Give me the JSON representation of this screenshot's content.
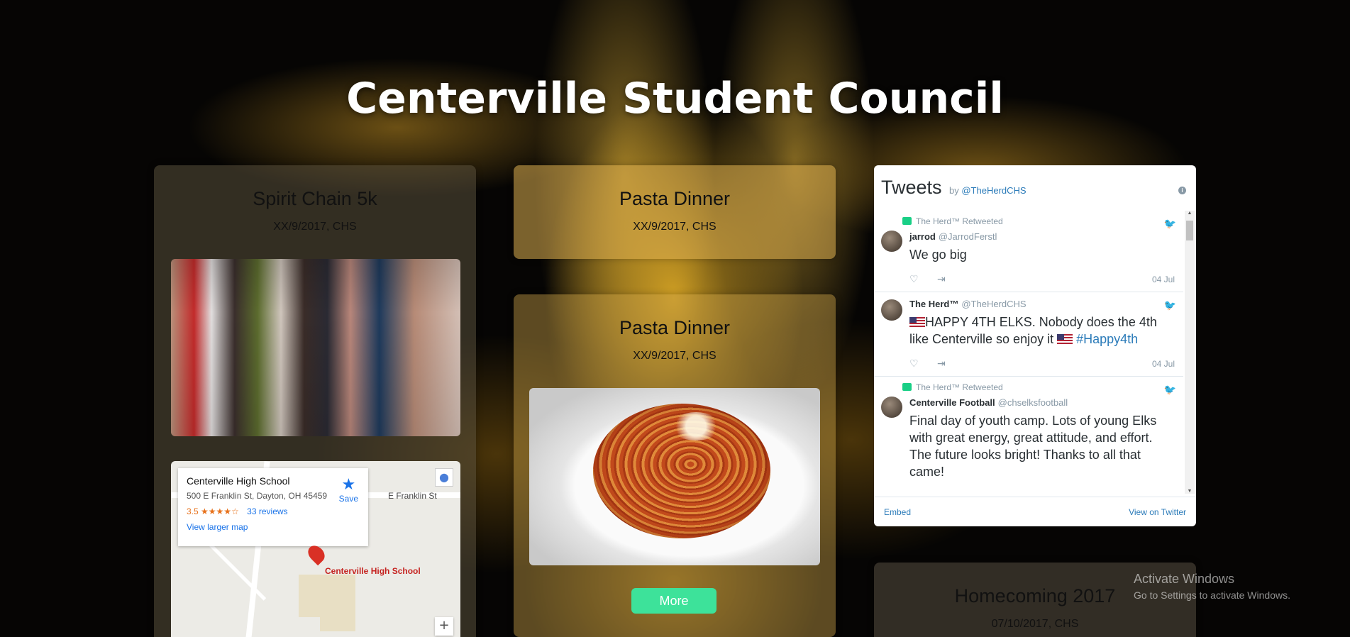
{
  "site": {
    "title": "Centerville Student Council"
  },
  "cards": {
    "spirit": {
      "title": "Spirit Chain 5k",
      "meta": "XX/9/2017, CHS"
    },
    "pasta_small": {
      "title": "Pasta Dinner",
      "meta": "XX/9/2017, CHS"
    },
    "pasta_large": {
      "title": "Pasta Dinner",
      "meta": "XX/9/2017, CHS",
      "button": "More"
    },
    "homecoming": {
      "title": "Homecoming 2017",
      "meta": "07/10/2017, CHS"
    }
  },
  "map": {
    "place": "Centerville High School",
    "address": "500 E Franklin St, Dayton, OH 45459",
    "rating": "3.5",
    "stars": "★★★★☆",
    "reviews": "33 reviews",
    "save": "Save",
    "larger": "View larger map",
    "street": "E Franklin St",
    "pin_label": "Centerville High School",
    "zoom_in": "+"
  },
  "twitter": {
    "title": "Tweets",
    "by": "by",
    "handle": "@TheHerdCHS",
    "tweets": [
      {
        "retweet_label": "The Herd™ Retweeted",
        "name": "jarrod",
        "handle": "@JarrodFerstl",
        "text": "We go big",
        "date": "04 Jul"
      },
      {
        "name": "The Herd™",
        "handle": "@TheHerdCHS",
        "text_a": "HAPPY 4TH ELKS. Nobody does the 4th like Centerville so enjoy it",
        "hashtag": "#Happy4th",
        "date": "04 Jul"
      },
      {
        "retweet_label": "The Herd™ Retweeted",
        "name": "Centerville Football",
        "handle": "@chselksfootball",
        "text": "Final day of youth camp. Lots of young Elks with great energy, great attitude, and effort. The future looks bright! Thanks to all that came!"
      }
    ],
    "embed": "Embed",
    "view_on": "View on Twitter"
  },
  "windows_watermark": {
    "line1": "Activate Windows",
    "line2": "Go to Settings to activate Windows."
  },
  "colors": {
    "accent_button": "#3de29a",
    "twitter_link": "#2b7bb9"
  }
}
